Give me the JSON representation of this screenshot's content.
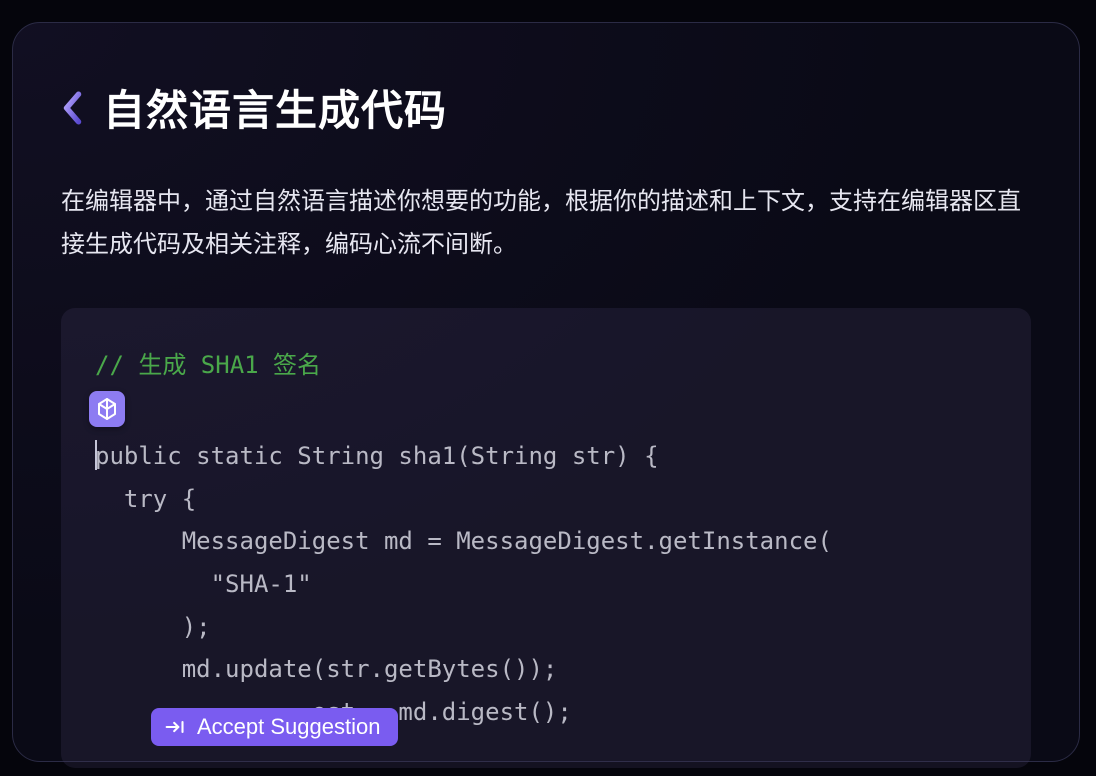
{
  "feature": {
    "title": "自然语言生成代码",
    "description": "在编辑器中，通过自然语言描述你想要的功能，根据你的描述和上下文，支持在编辑器区直接生成代码及相关注释，编码心流不间断。"
  },
  "code": {
    "comment": "// 生成 SHA1 签名",
    "lines": [
      "public static String sha1(String str) {",
      "  try {",
      "      MessageDigest md = MessageDigest.getInstance(",
      "        \"SHA-1\"",
      "      );",
      "      md.update(str.getBytes());",
      "               est = md.digest();"
    ]
  },
  "action": {
    "accept_label": "Accept Suggestion"
  },
  "icons": {
    "chevron_left": "chevron-left-icon",
    "ai_assistant": "ai-assistant-icon",
    "tab_key": "tab-key-icon"
  }
}
